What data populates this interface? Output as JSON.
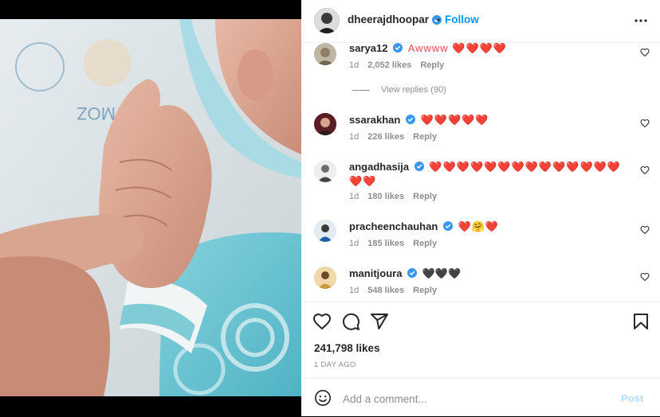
{
  "post": {
    "username": "dheerajdhoopar",
    "follow_label": "Follow",
    "separator": "•",
    "likes": "241,798 likes",
    "time": "1 DAY AGO"
  },
  "comments": [
    {
      "user": "sarya12",
      "text": "Awwww ❤️❤️❤️❤️",
      "time": "1d",
      "likes": "2,052 likes",
      "reply": "Reply",
      "verified": true
    },
    {
      "user": "ssarakhan",
      "text": "❤️❤️❤️❤️❤️",
      "time": "1d",
      "likes": "226 likes",
      "reply": "Reply",
      "verified": true
    },
    {
      "user": "angadhasija",
      "text": "❤️❤️❤️❤️❤️❤️❤️❤️❤️❤️❤️❤️❤️❤️❤️❤️",
      "time": "1d",
      "likes": "180 likes",
      "reply": "Reply",
      "verified": true
    },
    {
      "user": "pracheenchauhan",
      "text": "❤️🤗❤️",
      "time": "1d",
      "likes": "185 likes",
      "reply": "Reply",
      "verified": true
    },
    {
      "user": "manitjoura",
      "text": "🖤🖤🖤",
      "time": "1d",
      "likes": "548 likes",
      "reply": "Reply",
      "verified": true
    }
  ],
  "view_replies": "View replies (90)",
  "add_comment": {
    "placeholder": "Add a comment...",
    "post_label": "Post"
  },
  "icons": {
    "more": "more-horizontal-icon",
    "like": "heart-icon",
    "comment": "comment-icon",
    "share": "share-icon",
    "save": "bookmark-icon",
    "emoji": "emoji-icon"
  },
  "colors": {
    "accent": "#0095f6",
    "verified": "#3897f0",
    "heart": "#ed4956",
    "muted": "#8e8e8e"
  }
}
